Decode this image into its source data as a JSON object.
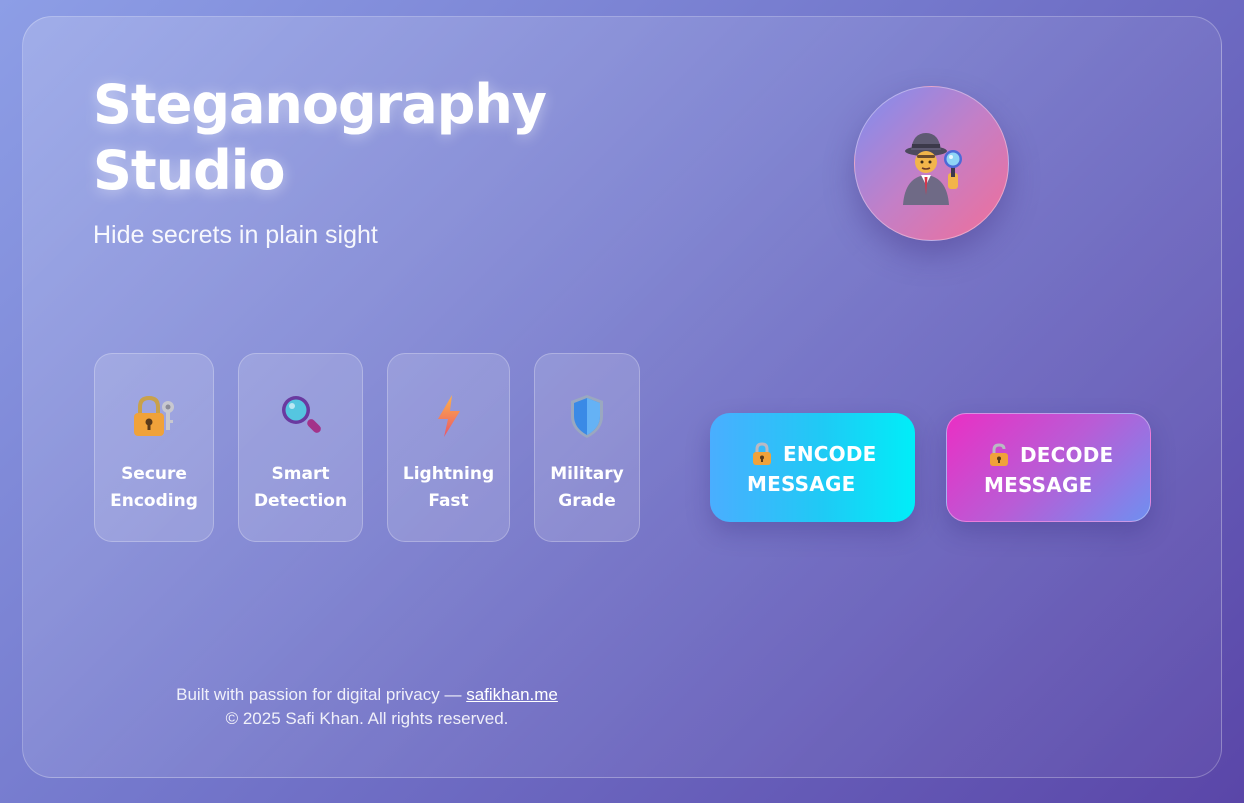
{
  "hero": {
    "title": "Steganography Studio",
    "subtitle": "Hide secrets in plain sight",
    "avatar_icon": "detective-icon"
  },
  "features": [
    {
      "label": "Secure Encoding",
      "icon": "lock-with-key-icon"
    },
    {
      "label": "Smart Detection",
      "icon": "magnifying-glass-icon"
    },
    {
      "label": "Lightning Fast",
      "icon": "lightning-icon"
    },
    {
      "label": "Military Grade",
      "icon": "shield-icon"
    }
  ],
  "actions": {
    "encode": {
      "label": "ENCODE MESSAGE",
      "icon": "locked-icon"
    },
    "decode": {
      "label": "DECODE MESSAGE",
      "icon": "unlocked-icon"
    }
  },
  "footer": {
    "built_text": "Built with passion for digital privacy —",
    "link_text": "safikhan.me",
    "copyright": "© 2025 Safi Khan. All rights reserved."
  },
  "colors": {
    "background_start": "#8d9ee6",
    "background_end": "#5a46a8",
    "encode_button": "#1fcaf5",
    "decode_button": "#ea2fc4",
    "avatar_gradient_start": "#7d8ef0",
    "avatar_gradient_end": "#f26e98"
  }
}
